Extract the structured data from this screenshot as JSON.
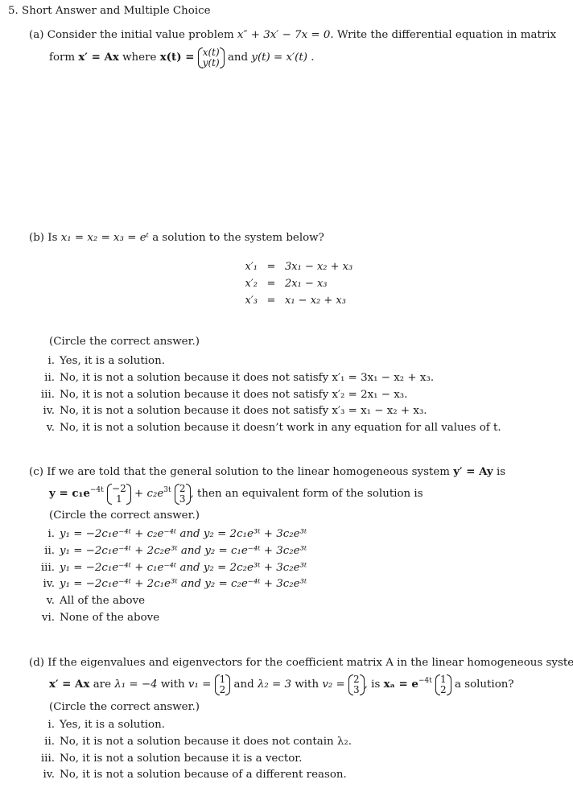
{
  "problem": {
    "heading": "5. Short Answer and Multiple Choice"
  },
  "part_a": {
    "label": "(a)",
    "line1_text": "Consider the initial value problem",
    "line1_equation": "x″ + 3x′ − 7x = 0.",
    "line1_tail": "Write the differential equation in matrix",
    "line2_text": "form",
    "line2_equation": "x′ = Ax",
    "line2_where": "where",
    "x_of_t": "x(t) =",
    "vector_top": "x(t)",
    "vector_bottom": "y(t)",
    "line2_and": "and",
    "y_def": "y(t) = x′(t) ."
  },
  "part_b": {
    "label": "(b)",
    "question_text": "Is",
    "question_equation": "x₁ = x₂ = x₃ = eᵗ",
    "question_tail": "a solution to the system below?",
    "system": [
      {
        "lhs": "x′₁",
        "rhs": "3x₁ − x₂ + x₃"
      },
      {
        "lhs": "x′₂",
        "rhs": "2x₁ − x₃"
      },
      {
        "lhs": "x′₃",
        "rhs": "x₁ − x₂ + x₃"
      }
    ],
    "instruction": "(Circle the correct answer.)",
    "options": [
      {
        "num": "i.",
        "text": "Yes, it is a solution."
      },
      {
        "num": "ii.",
        "text": "No, it is not a solution because it does not satisfy x′₁ = 3x₁ − x₂ + x₃."
      },
      {
        "num": "iii.",
        "text": "No, it is not a solution because it does not satisfy x′₂ = 2x₁ − x₃."
      },
      {
        "num": "iv.",
        "text": "No, it is not a solution because it does not satisfy x′₃ = x₁ − x₂ + x₃."
      },
      {
        "num": "v.",
        "text": "No, it is not a solution because it doesn’t work in any equation for all values of t."
      }
    ]
  },
  "part_c": {
    "label": "(c)",
    "line1_text": "If we are told that the general solution to the linear homogeneous system",
    "line1_equation": "y′ = Ay",
    "line1_tail": "is",
    "solution_prefix": "y = c₁e",
    "exp1": "−4t",
    "vec1_top": "−2",
    "vec1_bottom": "1",
    "plus_term": "+ c₂e",
    "exp2": "3t",
    "vec2_top": "2",
    "vec2_bottom": "3",
    "line2_tail": ", then an equivalent form of the solution is",
    "instruction": "(Circle the correct answer.)",
    "options": [
      {
        "num": "i.",
        "text": "y₁ = −2c₁e⁻⁴ᵗ + c₂e⁻⁴ᵗ and y₂ = 2c₁e³ᵗ + 3c₂e³ᵗ"
      },
      {
        "num": "ii.",
        "text": "y₁ = −2c₁e⁻⁴ᵗ + 2c₂e³ᵗ and y₂ = c₁e⁻⁴ᵗ + 3c₂e³ᵗ"
      },
      {
        "num": "iii.",
        "text": "y₁ = −2c₁e⁻⁴ᵗ + c₁e⁻⁴ᵗ and y₂ = 2c₂e³ᵗ + 3c₂e³ᵗ"
      },
      {
        "num": "iv.",
        "text": "y₁ = −2c₁e⁻⁴ᵗ + 2c₁e³ᵗ and y₂ = c₂e⁻⁴ᵗ + 3c₂e³ᵗ"
      },
      {
        "num": "v.",
        "text": "All of the above"
      },
      {
        "num": "vi.",
        "text": "None of the above"
      }
    ]
  },
  "part_d": {
    "label": "(d)",
    "line1_text": "If the eigenvalues and eigenvectors for the coefficient matrix A in the linear homogeneous system",
    "eq_system": "x′ = Ax",
    "are": "are",
    "lambda1": "λ₁ = −4",
    "with1": "with",
    "v1_label": "v₁ =",
    "v1_top": "1",
    "v1_bottom": "2",
    "and": "and",
    "lambda2": "λ₂ = 3",
    "with2": "with",
    "v2_label": "v₂ =",
    "v2_top": "2",
    "v2_bottom": "3",
    "is_text": ", is",
    "xa_label": "xₐ = e",
    "xa_exp": "−4t",
    "xa_top": "1",
    "xa_bottom": "2",
    "tail": "a solution?",
    "instruction": "(Circle the correct answer.)",
    "options": [
      {
        "num": "i.",
        "text": "Yes, it is a solution."
      },
      {
        "num": "ii.",
        "text": "No, it is not a solution because it does not contain λ₂."
      },
      {
        "num": "iii.",
        "text": "No, it is not a solution because it is a vector."
      },
      {
        "num": "iv.",
        "text": "No, it is not a solution because of a different reason."
      }
    ]
  }
}
